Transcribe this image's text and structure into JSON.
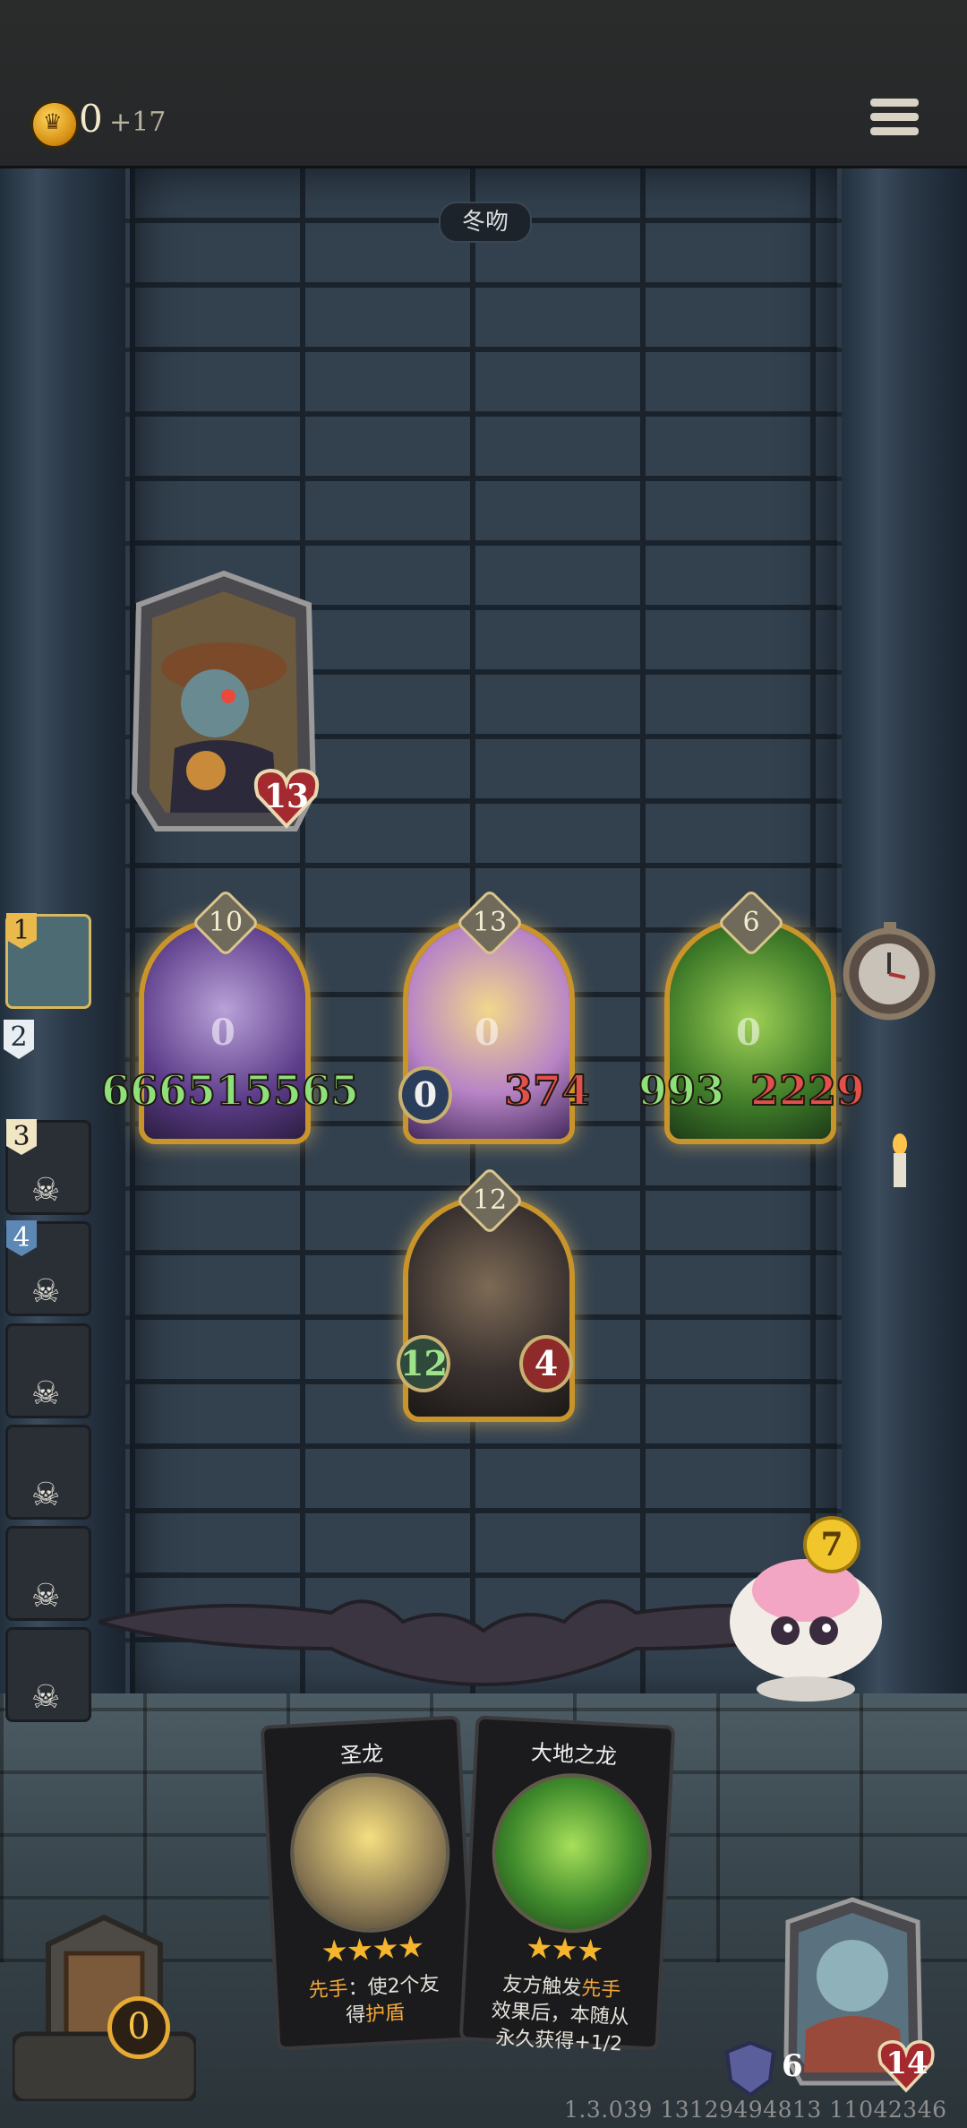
{
  "top_bar": {
    "gold": "0",
    "income": "+17",
    "menu_icon": "hamburger-menu-icon",
    "coin_icon": "crown-coin-icon"
  },
  "opponent": {
    "name": "冬吻",
    "health": "13"
  },
  "board": {
    "minions": [
      {
        "tier": "10",
        "attack": "666515565",
        "health": "",
        "shield": "0"
      },
      {
        "tier": "13",
        "attack": "0",
        "health": "374",
        "shield": "0"
      },
      {
        "tier": "6",
        "attack": "993",
        "health": "2229",
        "shield": "0"
      },
      {
        "tier": "12",
        "attack": "12",
        "health": "4"
      }
    ]
  },
  "sidebar": {
    "players": [
      {
        "rank": "1",
        "state": "alive"
      },
      {
        "rank": "2",
        "state": "alive"
      },
      {
        "rank": "3",
        "state": "dead"
      },
      {
        "rank": "4",
        "state": "dead"
      },
      {
        "rank": "",
        "state": "dead"
      },
      {
        "rank": "",
        "state": "dead"
      },
      {
        "rank": "",
        "state": "dead"
      },
      {
        "rank": "",
        "state": "dead"
      }
    ]
  },
  "mascot": {
    "value": "7"
  },
  "shop": {
    "cards": [
      {
        "name": "圣龙",
        "stars": "★★★★",
        "desc_prefix": "先手",
        "desc_mid": "：使2个友",
        "desc_line2a": "得",
        "desc_highlight": "护盾"
      },
      {
        "name": "大地之龙",
        "stars": "★★★",
        "desc_a": "友方触发",
        "desc_highlight": "先手",
        "desc_b": "效果后，本随从",
        "desc_c": "永久获得+1/2"
      }
    ]
  },
  "player": {
    "armor": "6",
    "health": "14",
    "chest_count": "0"
  },
  "footer": {
    "version": "1.3.039 13129494813 11042346"
  },
  "colors": {
    "gold": "#c9952b",
    "attack": "#8fe07a",
    "health": "#e2504b",
    "highlight": "#f3a73a"
  }
}
